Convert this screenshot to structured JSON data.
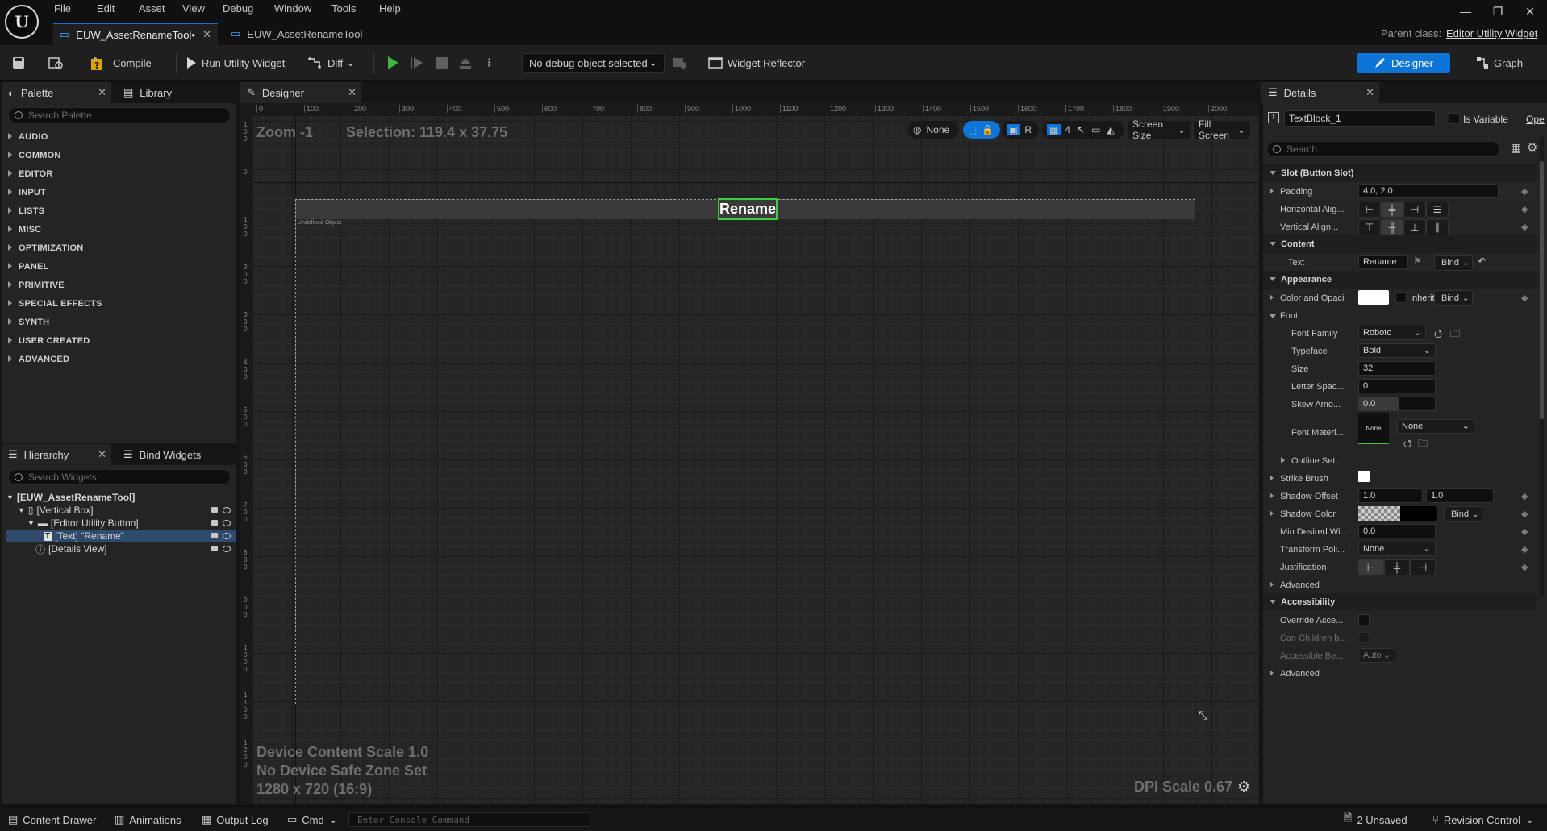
{
  "menu": [
    "File",
    "Edit",
    "Asset",
    "View",
    "Debug",
    "Window",
    "Tools",
    "Help"
  ],
  "tabs": [
    {
      "label": "EUW_AssetRenameTool•"
    },
    {
      "label": "EUW_AssetRenameTool"
    }
  ],
  "parent_class_label": "Parent class:",
  "parent_class_value": "Editor Utility Widget",
  "toolbar": {
    "compile": "Compile",
    "run": "Run Utility Widget",
    "diff": "Diff",
    "debug_object": "No debug object selected",
    "widget_reflector": "Widget Reflector",
    "designer": "Designer",
    "graph": "Graph"
  },
  "palette": {
    "tab": "Palette",
    "library_tab": "Library",
    "search_placeholder": "Search Palette",
    "categories": [
      "AUDIO",
      "COMMON",
      "EDITOR",
      "INPUT",
      "LISTS",
      "MISC",
      "OPTIMIZATION",
      "PANEL",
      "PRIMITIVE",
      "SPECIAL EFFECTS",
      "SYNTH",
      "USER CREATED",
      "ADVANCED"
    ]
  },
  "hierarchy": {
    "tab": "Hierarchy",
    "bind_tab": "Bind Widgets",
    "search_placeholder": "Search Widgets",
    "items": [
      {
        "label": "[EUW_AssetRenameTool]"
      },
      {
        "label": "[Vertical Box]"
      },
      {
        "label": "[Editor Utility Button]"
      },
      {
        "label": "[Text] \"Rename\""
      },
      {
        "label": "[Details View]"
      }
    ]
  },
  "designer": {
    "tab": "Designer",
    "zoom": "Zoom -1",
    "selection": "Selection: 119.4 x 37.75",
    "none_btn": "None",
    "r_btn": "R",
    "grid_count": "4",
    "screen_size": "Screen Size",
    "fill_screen": "Fill Screen",
    "button_text": "Rename",
    "undefined_label": "Undefined Object",
    "device_scale": "Device Content Scale 1.0",
    "safe_zone": "No Device Safe Zone Set",
    "resolution": "1280 x 720 (16:9)",
    "dpi_scale": "DPI Scale 0.67",
    "ruler_x": [
      "0",
      "100",
      "200",
      "300",
      "400",
      "500",
      "600",
      "700",
      "800",
      "900",
      "1000",
      "1100",
      "1200",
      "1300",
      "1400",
      "1500",
      "1600",
      "1700",
      "1800",
      "1900",
      "2000"
    ],
    "ruler_y": [
      "1\n0\n0",
      "0",
      "1\n0\n0",
      "2\n0\n0",
      "3\n0\n0",
      "4\n0\n0",
      "5\n0\n0",
      "6\n0\n0",
      "7\n0\n0",
      "8\n0\n0",
      "9\n0\n0",
      "1\n0\n0\n0",
      "1\n1\n0\n0",
      "1\n2\n0\n0"
    ]
  },
  "details": {
    "tab": "Details",
    "name": "TextBlock_1",
    "is_variable": "Is Variable",
    "open": "Ope",
    "search_placeholder": "Search",
    "sections": {
      "slot": "Slot (Button Slot)",
      "content": "Content",
      "appearance": "Appearance",
      "font": "Font",
      "accessibility": "Accessibility"
    },
    "padding_label": "Padding",
    "padding_value": "4.0, 2.0",
    "halign_label": "Horizontal Alig...",
    "valign_label": "Vertical Align...",
    "text_label": "Text",
    "text_value": "Rename",
    "bind": "Bind",
    "color_label": "Color and Opaci",
    "inherit": "Inherit",
    "font_family_label": "Font Family",
    "font_family_value": "Roboto",
    "typeface_label": "Typeface",
    "typeface_value": "Bold",
    "size_label": "Size",
    "size_value": "32",
    "letter_spacing_label": "Letter Spac...",
    "letter_spacing_value": "0",
    "skew_label": "Skew Amo...",
    "skew_value": "0.0",
    "font_material_label": "Font Materi...",
    "font_material_swatch": "None",
    "font_material_value": "None",
    "outline_label": "Outline Set...",
    "strike_label": "Strike Brush",
    "shadow_offset_label": "Shadow Offset",
    "shadow_offset_x": "1.0",
    "shadow_offset_y": "1.0",
    "shadow_color_label": "Shadow Color",
    "min_width_label": "Min Desired Wi...",
    "min_width_value": "0.0",
    "transform_label": "Transform Poli...",
    "transform_value": "None",
    "justification_label": "Justification",
    "advanced_label": "Advanced",
    "override_label": "Override Acce...",
    "can_children_label": "Can Children b...",
    "accessible_label": "Accessible Be...",
    "accessible_value": "Auto",
    "advanced2_label": "Advanced"
  },
  "status": {
    "content_drawer": "Content Drawer",
    "animations": "Animations",
    "output_log": "Output Log",
    "cmd": "Cmd",
    "console_placeholder": "Enter Console Command",
    "unsaved": "2 Unsaved",
    "revision": "Revision Control"
  },
  "colors": {
    "accent": "#0e75d8",
    "selection_green": "#3ec93e",
    "selected_row": "#2e4b6e"
  }
}
